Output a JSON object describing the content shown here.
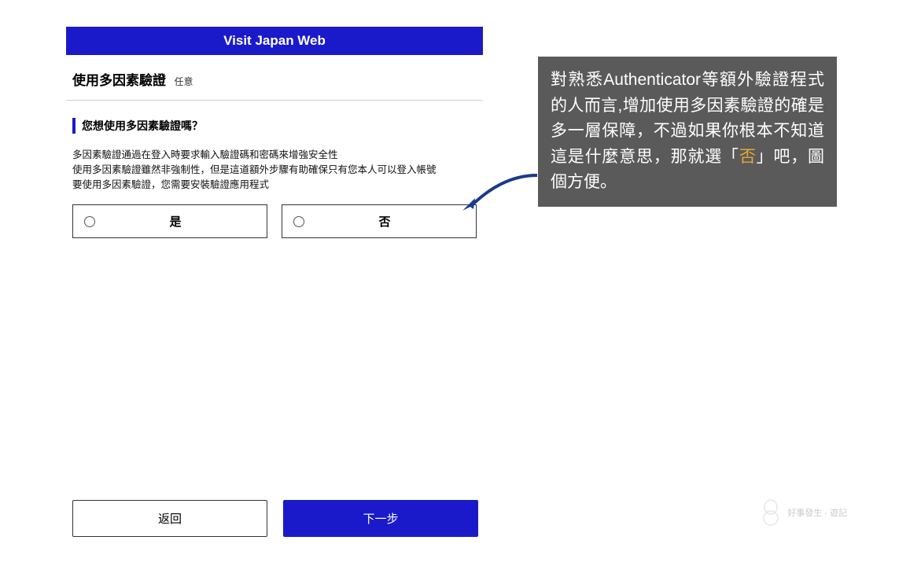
{
  "header": {
    "title": "Visit Japan Web"
  },
  "page": {
    "title": "使用多因素驗證",
    "optional": "任意"
  },
  "question": "您想使用多因素驗證嗎？",
  "description": {
    "line1": "多因素驗證通過在登入時要求輸入驗證碼和密碼來增強安全性",
    "line2": "使用多因素驗證雖然非強制性，但是這道額外步驟有助確保只有您本人可以登入帳號",
    "line3": "要使用多因素驗證，您需要安裝驗證應用程式"
  },
  "options": {
    "yes": "是",
    "no": "否"
  },
  "footer": {
    "back": "返回",
    "next": "下一步"
  },
  "annotation": {
    "part1": "對熟悉Authenticator等額外驗證程式的人而言,增加使用多因素驗證的確是多一層保障，不過如果你根本不知道這是什麼意思，那就選「",
    "highlight": "否",
    "part2": "」吧，圖個方便。"
  },
  "watermark": {
    "text": "好事發生 - 遊記"
  }
}
